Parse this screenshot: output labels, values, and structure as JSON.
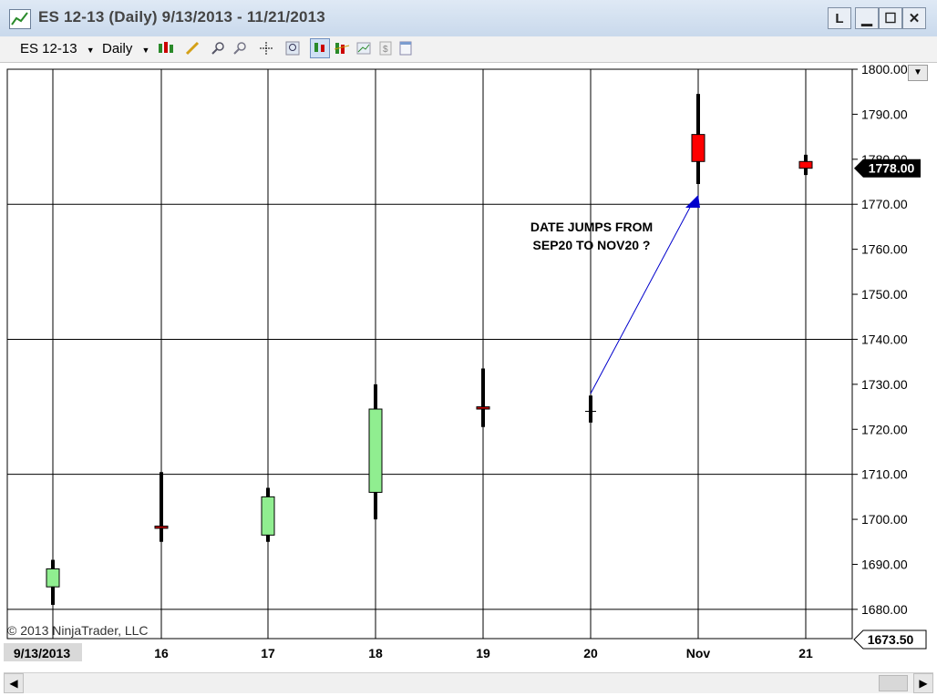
{
  "window": {
    "title": "ES 12-13 (Daily)  9/13/2013 - 11/21/2013",
    "buttons": [
      "L",
      "▁",
      "☐",
      "✕"
    ]
  },
  "toolbar": {
    "instrument": "ES 12-13",
    "interval": "Daily"
  },
  "chart_data": {
    "type": "candlestick",
    "instrument": "ES 12-13",
    "ylim": [
      1673.5,
      1800
    ],
    "y_ticks": [
      "1680.00",
      "1690.00",
      "1700.00",
      "1710.00",
      "1720.00",
      "1730.00",
      "1740.00",
      "1750.00",
      "1760.00",
      "1770.00",
      "1780.00",
      "1790.00",
      "1800.00"
    ],
    "x_labels": [
      "9/13/2013",
      "16",
      "17",
      "18",
      "19",
      "20",
      "Nov",
      "21"
    ],
    "candles": [
      {
        "label": "9/13/2013",
        "open": 1685,
        "high": 1691,
        "low": 1681,
        "close": 1689,
        "color": "#90ee90"
      },
      {
        "label": "16",
        "open": 1698.5,
        "high": 1710.5,
        "low": 1695,
        "close": 1698,
        "color": "#cc0000"
      },
      {
        "label": "17",
        "open": 1696.5,
        "high": 1707,
        "low": 1695,
        "close": 1705,
        "color": "#90ee90"
      },
      {
        "label": "18",
        "open": 1706,
        "high": 1730,
        "low": 1700,
        "close": 1724.5,
        "color": "#90ee90"
      },
      {
        "label": "19",
        "open": 1725,
        "high": 1733.5,
        "low": 1720.5,
        "close": 1724.5,
        "color": "#cc0000"
      },
      {
        "label": "20",
        "open": 1724,
        "high": 1727.5,
        "low": 1721.5,
        "close": 1724,
        "color": "#000000"
      },
      {
        "label": "Nov",
        "open": 1785.5,
        "high": 1794.5,
        "low": 1774.5,
        "close": 1779.5,
        "color": "#ff0000"
      },
      {
        "label": "21",
        "open": 1779.5,
        "high": 1781,
        "low": 1776.5,
        "close": 1778,
        "color": "#ff0000"
      }
    ],
    "last_price": "1778.00",
    "low_marker": "1673.50",
    "annotation": {
      "line1": "DATE JUMPS FROM",
      "line2": "SEP20 TO NOV20 ?"
    },
    "copyright": "© 2013 NinjaTrader, LLC",
    "grid": true
  }
}
